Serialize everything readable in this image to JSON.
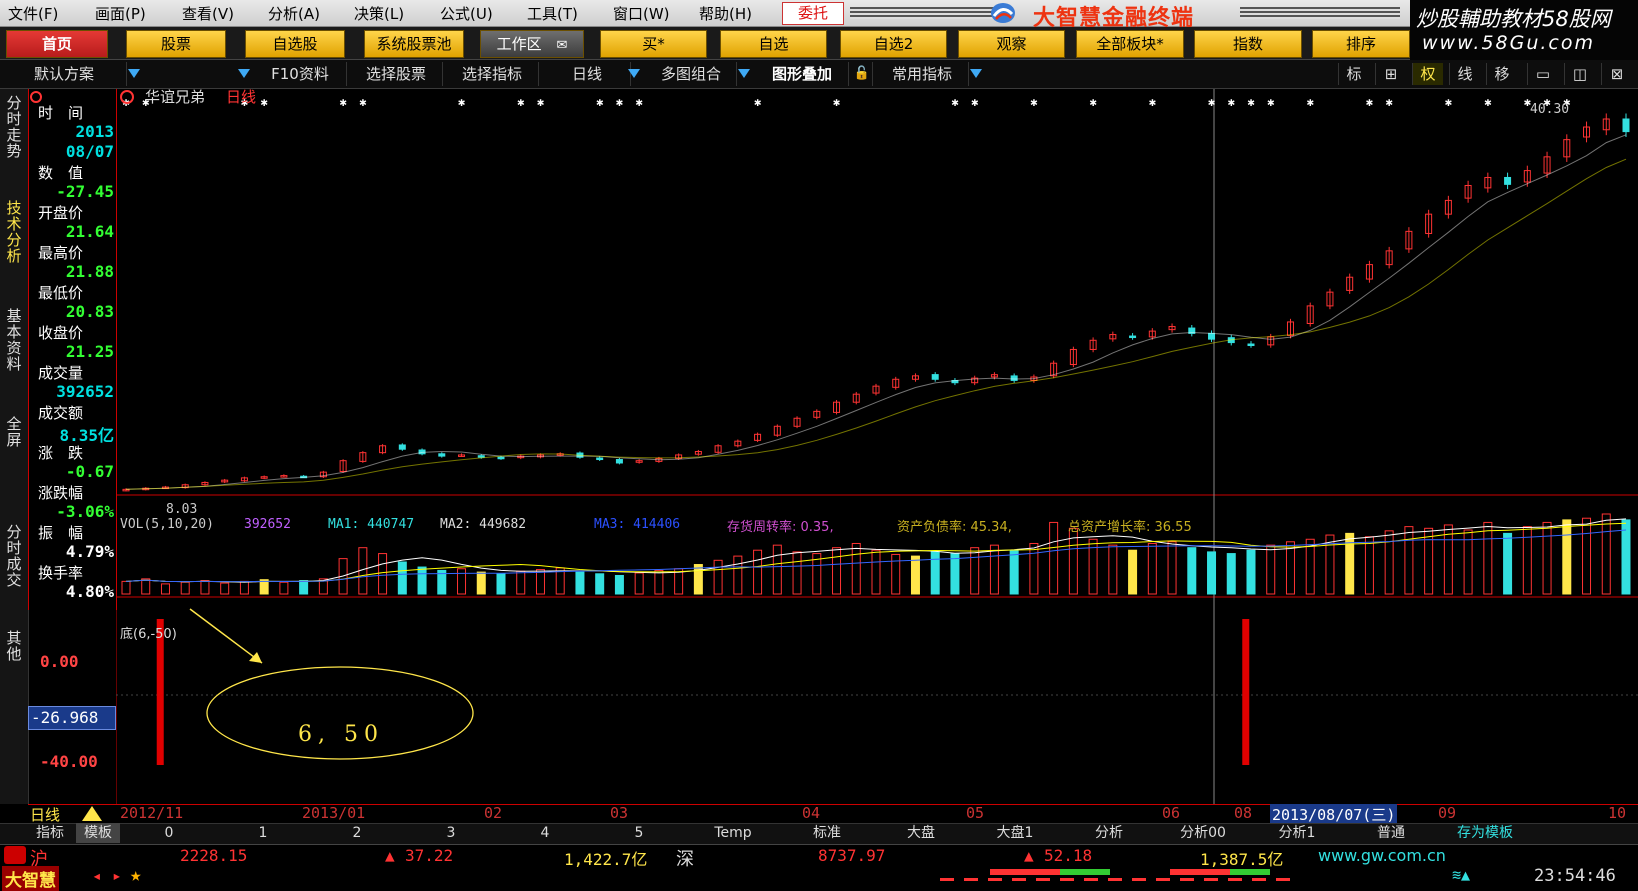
{
  "menu": {
    "items": [
      "文件(F)",
      "画面(P)",
      "查看(V)",
      "分析(A)",
      "决策(L)",
      "公式(U)",
      "工具(T)",
      "窗口(W)",
      "帮助(H)"
    ],
    "entrust": "委托",
    "brand_title": "大智慧金融终端",
    "ad_line1": "炒股輔助教材58股网",
    "ad_line2": "www.58Gu.com"
  },
  "nav": {
    "buttons": [
      "首页",
      "股票",
      "自选股",
      "系统股票池",
      "工作区",
      "买*",
      "自选",
      "自选2",
      "观察",
      "全部板块*",
      "指数",
      "排序"
    ]
  },
  "toolbar": {
    "scheme": "默认方案",
    "f10": "F10资料",
    "select_stock": "选择股票",
    "select_indicator": "选择指标",
    "period": "日线",
    "multi_chart": "多图组合",
    "overlay": "图形叠加",
    "common_indicator": "常用指标",
    "right_icons": [
      "标",
      "⊞",
      "权",
      "线",
      "移",
      "▭",
      "◫",
      "⊠"
    ]
  },
  "vtabs": [
    "分时走势",
    "技术分析",
    "基本资料",
    "全屏",
    "分时成交",
    "其他"
  ],
  "info_panel": {
    "fields": [
      {
        "label": "时　间",
        "value": "2013",
        "value2": "08/07",
        "color": "#00e0e0"
      },
      {
        "label": "数　值",
        "value": "-27.45",
        "color": "#33ff33"
      },
      {
        "label": "开盘价",
        "value": "21.64",
        "color": "#33ff33"
      },
      {
        "label": "最高价",
        "value": "21.88",
        "color": "#33ff33"
      },
      {
        "label": "最低价",
        "value": "20.83",
        "color": "#33ff33"
      },
      {
        "label": "收盘价",
        "value": "21.25",
        "color": "#33ff33"
      },
      {
        "label": "成交量",
        "value": "392652",
        "color": "#00e0e0"
      },
      {
        "label": "成交额",
        "value": "8.35亿",
        "color": "#00e0e0"
      },
      {
        "label": "涨　跌",
        "value": "-0.67",
        "color": "#33ff33"
      },
      {
        "label": "涨跌幅",
        "value": "-3.06%",
        "color": "#33ff33"
      },
      {
        "label": "振　幅",
        "value": "4.79%",
        "color": "#ffffff"
      },
      {
        "label": "换手率",
        "value": "4.80%",
        "color": "#ffffff"
      }
    ]
  },
  "chart": {
    "stock_name": "华谊兄弟",
    "period": "日线",
    "price_marker_high": "40.30",
    "price_marker_low": "8.03",
    "vol_legend": {
      "title": "VOL(5,10,20)",
      "vol": "392652",
      "ma1": "MA1: 440747",
      "ma2": "MA2: 449682",
      "ma3": "MA3: 414406",
      "extra1": "存货周转率: 0.35,",
      "extra2": "资产负债率: 45.34,",
      "extra3": "总资产增长率: 36.55"
    },
    "indicator_title": "底(6,-50)",
    "indicator_axis": [
      "0.00",
      "-26.968",
      "-40.00"
    ],
    "annotation": "6, 50",
    "time_axis_labels": [
      "日线",
      "2012/11",
      "2013/01",
      "02",
      "03",
      "04",
      "05",
      "06",
      "08",
      "2013/08/07(三)",
      "09",
      "10"
    ]
  },
  "chart_data": {
    "type": "candlestick",
    "title": "华谊兄弟 日线",
    "x_range": [
      "2012/11",
      "2013/10"
    ],
    "price_range": [
      8.03,
      40.3
    ],
    "last_bar": {
      "date": "2013/08/07",
      "open": 21.64,
      "high": 21.88,
      "low": 20.83,
      "close": 21.25,
      "volume": 392652,
      "amount": "8.35亿",
      "change": -0.67,
      "change_pct": "-3.06%",
      "amplitude": "4.79%",
      "turnover": "4.80%"
    },
    "close_series": [
      8.0,
      8.1,
      8.2,
      8.4,
      8.6,
      8.8,
      9.0,
      9.1,
      9.2,
      9.1,
      9.5,
      10.5,
      11.2,
      11.8,
      11.5,
      11.1,
      10.9,
      11.0,
      10.8,
      10.7,
      10.9,
      11.0,
      11.1,
      10.8,
      10.6,
      10.3,
      10.5,
      10.7,
      11.0,
      11.3,
      11.8,
      12.2,
      12.8,
      13.5,
      14.2,
      14.8,
      15.6,
      16.3,
      17.0,
      17.6,
      17.9,
      17.6,
      17.3,
      17.7,
      18.0,
      17.5,
      17.8,
      19.0,
      20.2,
      21.0,
      21.5,
      21.3,
      21.8,
      22.2,
      21.6,
      21.1,
      20.8,
      20.6,
      21.3,
      22.6,
      24.0,
      25.2,
      26.5,
      27.6,
      28.8,
      30.5,
      32.0,
      33.2,
      34.5,
      35.2,
      34.6,
      35.8,
      37.0,
      38.5,
      39.6,
      40.3,
      39.2
    ],
    "volume_series": [
      15,
      18,
      12,
      14,
      16,
      13,
      15,
      17,
      14,
      16,
      18,
      42,
      55,
      48,
      38,
      32,
      28,
      30,
      26,
      24,
      27,
      29,
      31,
      26,
      24,
      22,
      25,
      28,
      30,
      35,
      40,
      45,
      52,
      58,
      50,
      48,
      55,
      60,
      52,
      47,
      45,
      50,
      48,
      55,
      58,
      52,
      60,
      85,
      78,
      65,
      58,
      52,
      60,
      62,
      55,
      50,
      48,
      52,
      58,
      62,
      65,
      70,
      72,
      68,
      75,
      80,
      78,
      82,
      76,
      85,
      72,
      80,
      85,
      88,
      90,
      95,
      88
    ],
    "indicator": {
      "name": "底(6,-50)",
      "value_at_cursor": -26.968,
      "ticks": [
        0.0,
        -40.0
      ],
      "signals_index": [
        1,
        56
      ]
    }
  },
  "template_tabs": [
    "指标",
    "模板",
    "0",
    "1",
    "2",
    "3",
    "4",
    "5",
    "Temp",
    "标准",
    "大盘",
    "大盘1",
    "分析",
    "分析00",
    "分析1",
    "普通",
    "存为模板"
  ],
  "status": {
    "sh_label": "沪",
    "sh_index": "2228.15",
    "sh_change": "37.22",
    "sh_amount": "1,422.7亿",
    "sz_label": "深",
    "sz_index": "8737.97",
    "sz_change": "52.18",
    "sz_amount": "1,387.5亿",
    "website": "www.gw.com.cn",
    "clock": "23:54:46",
    "app_name": "大智慧"
  },
  "colors": {
    "up": "#ff3333",
    "down": "#33e0e0",
    "ma1": "#ffffff",
    "ma2": "#ffff00",
    "ma3": "#3366ff",
    "accent_yellow": "#ffe64a"
  }
}
